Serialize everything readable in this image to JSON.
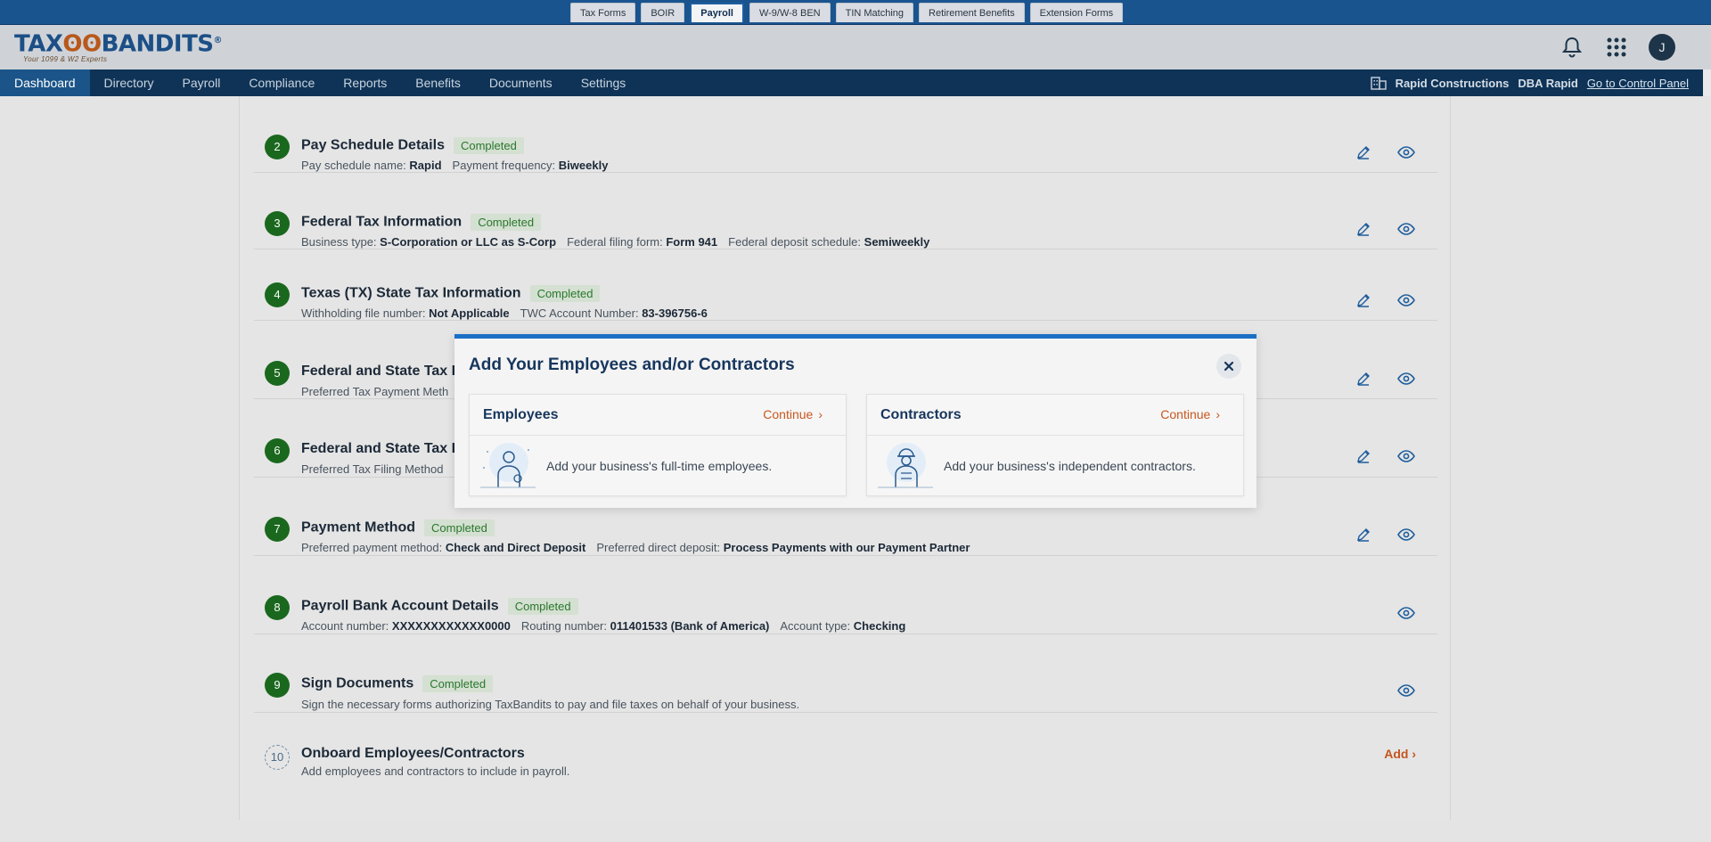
{
  "product_tabs": [
    "Tax Forms",
    "BOIR",
    "Payroll",
    "W-9/W-8 BEN",
    "TIN Matching",
    "Retirement Benefits",
    "Extension Forms"
  ],
  "active_product_tab": "Payroll",
  "logo": {
    "brand_left": "TAX",
    "brand_right": "BANDITS",
    "registered": "®",
    "tagline": "Your 1099 & W2 Experts"
  },
  "header": {
    "avatar_initial": "J",
    "icons": [
      "bell-icon",
      "apps-grid-icon"
    ]
  },
  "nav": {
    "items": [
      "Dashboard",
      "Directory",
      "Payroll",
      "Compliance",
      "Reports",
      "Benefits",
      "Documents",
      "Settings"
    ],
    "active": "Dashboard",
    "company": "Rapid Constructions",
    "dba": "DBA Rapid",
    "control_panel": "Go to Control Panel"
  },
  "steps": [
    {
      "num": "2",
      "title": "Pay Schedule Details",
      "status": "Completed",
      "details": [
        {
          "label": "Pay schedule name:",
          "value": "Rapid"
        },
        {
          "label": "Payment frequency:",
          "value": "Biweekly"
        }
      ]
    },
    {
      "num": "3",
      "title": "Federal Tax Information",
      "status": "Completed",
      "details": [
        {
          "label": "Business type:",
          "value": "S-Corporation or LLC as S-Corp"
        },
        {
          "label": "Federal filing form:",
          "value": "Form 941"
        },
        {
          "label": "Federal deposit schedule:",
          "value": "Semiweekly"
        }
      ]
    },
    {
      "num": "4",
      "title": "Texas (TX) State Tax Information",
      "status": "Completed",
      "details": [
        {
          "label": "Withholding file number:",
          "value": "Not Applicable"
        },
        {
          "label": "TWC Account Number:",
          "value": "83-396756-6"
        }
      ]
    },
    {
      "num": "5",
      "title": "Federal and State Tax P",
      "details": [
        {
          "label": "Preferred Tax Payment Meth",
          "value": ""
        }
      ]
    },
    {
      "num": "6",
      "title": "Federal and State Tax Fi",
      "details": [
        {
          "label": "Preferred Tax Filing Method",
          "value": ""
        }
      ]
    },
    {
      "num": "7",
      "title": "Payment Method",
      "status": "Completed",
      "details": [
        {
          "label": "Preferred payment method:",
          "value": "Check and Direct Deposit"
        },
        {
          "label": "Preferred direct deposit:",
          "value": "Process Payments with our Payment Partner"
        }
      ]
    },
    {
      "num": "8",
      "title": "Payroll Bank Account Details",
      "status": "Completed",
      "details": [
        {
          "label": "Account number:",
          "value": "XXXXXXXXXXXX0000"
        },
        {
          "label": "Routing number:",
          "value": "011401533 (Bank of America)"
        },
        {
          "label": "Account type:",
          "value": "Checking"
        }
      ]
    },
    {
      "num": "9",
      "title": "Sign Documents",
      "status": "Completed",
      "description": "Sign the necessary forms authorizing TaxBandits to pay and file taxes on behalf of your business."
    },
    {
      "num": "10",
      "title": "Onboard Employees/Contractors",
      "description": "Add employees and contractors to include in payroll.",
      "action_label": "Add"
    }
  ],
  "modal": {
    "title": "Add Your Employees and/or Contractors",
    "cards": [
      {
        "title": "Employees",
        "continue_label": "Continue",
        "text": "Add your business's full-time employees."
      },
      {
        "title": "Contractors",
        "continue_label": "Continue",
        "text": "Add your business's independent contractors."
      }
    ]
  },
  "colors": {
    "brand_blue": "#1a6fc4",
    "nav_bg": "#0f3356",
    "accent_orange": "#c8571f",
    "step_green": "#1b6b1f"
  }
}
